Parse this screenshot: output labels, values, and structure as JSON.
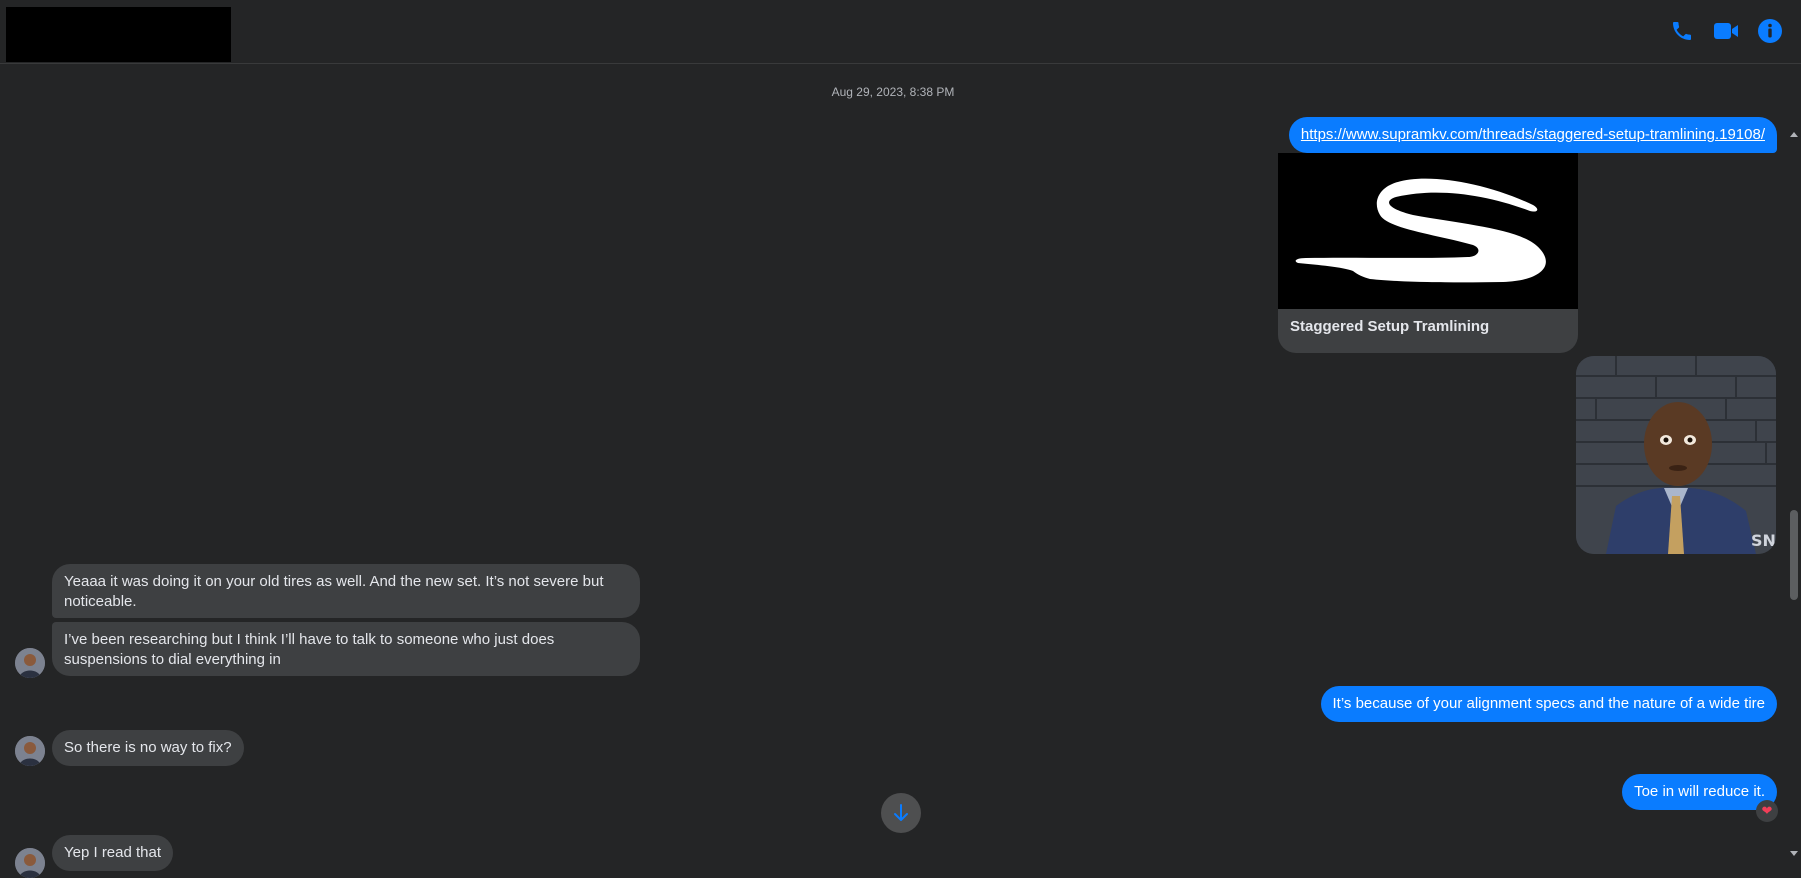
{
  "header": {
    "call_icon": "phone-icon",
    "video_icon": "video-camera-icon",
    "info_icon": "info-icon",
    "accent_color": "#0a7cff"
  },
  "conversation": {
    "timestamp": "Aug 29, 2023, 8:38 PM",
    "link_message": "https://www.supramkv.com/threads/staggered-setup-tramlining.19108/",
    "link_preview_title": "Staggered Setup Tramlining",
    "incoming_1": "Yeaaa it was doing it on your old tires as well. And the new set. It’s not severe but noticeable.",
    "incoming_2": "I’ve been researching but I think I’ll have to talk to someone who just does suspensions to dial everything in",
    "outgoing_1": "It’s because of your alignment specs and the nature of a wide tire",
    "incoming_3": "So there is no way to fix?",
    "outgoing_2": "Toe in will reduce it.",
    "reaction": "❤",
    "incoming_4": "Yep I read that"
  }
}
